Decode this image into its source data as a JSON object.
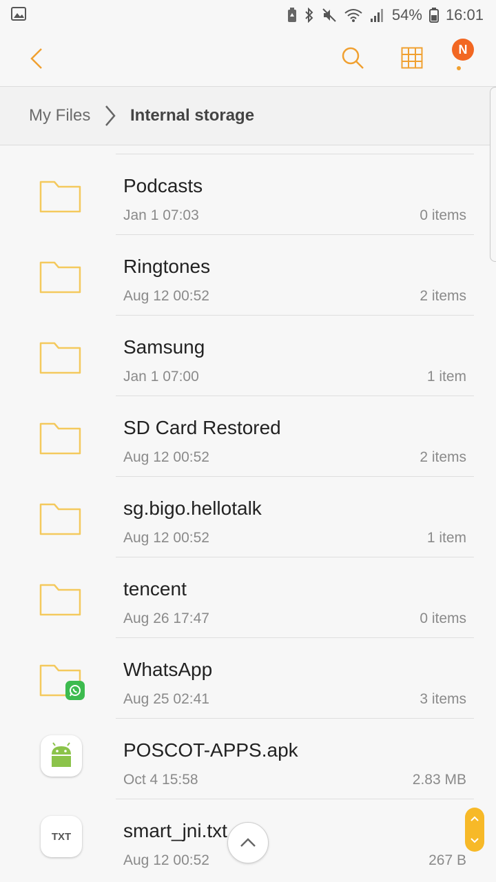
{
  "status_bar": {
    "battery_percent": "54%",
    "time": "16:01",
    "icons": [
      "image-icon",
      "battery-saver-icon",
      "bluetooth-icon",
      "mute-icon",
      "wifi-icon",
      "signal-icon",
      "battery-icon"
    ]
  },
  "app_bar": {
    "icons": [
      "back-icon",
      "search-icon",
      "grid-view-icon",
      "more-options-icon"
    ],
    "badge_letter": "N",
    "accent_color": "#f0a030",
    "badge_color": "#f26722"
  },
  "breadcrumb": {
    "root": "My Files",
    "current": "Internal storage"
  },
  "files": [
    {
      "name": "Podcasts",
      "date": "Jan 1 07:03",
      "meta": "0 items",
      "type": "folder"
    },
    {
      "name": "Ringtones",
      "date": "Aug 12 00:52",
      "meta": "2 items",
      "type": "folder"
    },
    {
      "name": "Samsung",
      "date": "Jan 1 07:00",
      "meta": "1 item",
      "type": "folder"
    },
    {
      "name": "SD Card Restored",
      "date": "Aug 12 00:52",
      "meta": "2 items",
      "type": "folder"
    },
    {
      "name": "sg.bigo.hellotalk",
      "date": "Aug 12 00:52",
      "meta": "1 item",
      "type": "folder"
    },
    {
      "name": "tencent",
      "date": "Aug 26 17:47",
      "meta": "0 items",
      "type": "folder"
    },
    {
      "name": "WhatsApp",
      "date": "Aug 25 02:41",
      "meta": "3 items",
      "type": "folder-whatsapp"
    },
    {
      "name": "POSCOT-APPS.apk",
      "date": "Oct 4 15:58",
      "meta": "2.83 MB",
      "type": "apk"
    },
    {
      "name": "smart_jni.txt",
      "date": "Aug 12 00:52",
      "meta": "267 B",
      "type": "txt",
      "icon_label": "TXT"
    }
  ]
}
